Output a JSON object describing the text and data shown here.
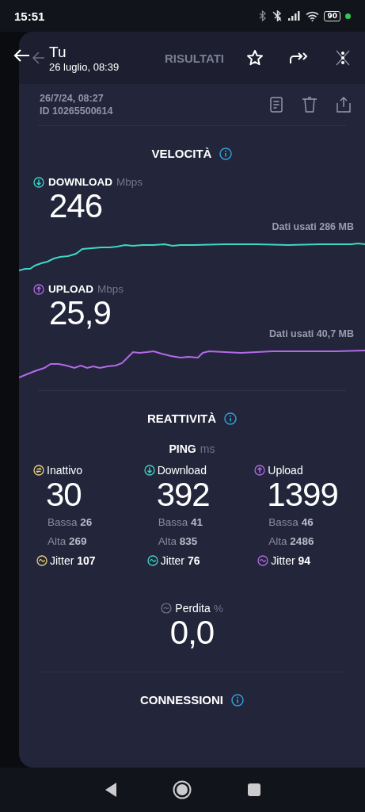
{
  "status_bar": {
    "time": "15:51",
    "battery": "90"
  },
  "overlay_header": {
    "title": "Tu",
    "subtitle": "26 luglio, 08:39"
  },
  "header": {
    "title": "RISULTATI"
  },
  "result": {
    "date": "26/7/24, 08:27",
    "id": "ID 10265500614"
  },
  "speed": {
    "title": "VELOCITÀ",
    "metrics": [
      {
        "kind": "download",
        "label": "DOWNLOAD",
        "unit": "Mbps",
        "value": "246",
        "data_used": "Dati usati 286 MB",
        "color": "#3fd6c6"
      },
      {
        "kind": "upload",
        "label": "UPLOAD",
        "unit": "Mbps",
        "value": "25,9",
        "data_used": "Dati usati 40,7 MB",
        "color": "#b36ae8"
      }
    ]
  },
  "responsiveness": {
    "title": "REATTIVITÀ",
    "ping_label": "PING",
    "ping_unit": "ms",
    "columns": [
      {
        "kind": "idle",
        "label": "Inattivo",
        "value": "30",
        "low_label": "Bassa",
        "low": "26",
        "high_label": "Alta",
        "high": "269",
        "jitter_label": "Jitter",
        "jitter": "107",
        "color": "#e8d27a"
      },
      {
        "kind": "download",
        "label": "Download",
        "value": "392",
        "low_label": "Bassa",
        "low": "41",
        "high_label": "Alta",
        "high": "835",
        "jitter_label": "Jitter",
        "jitter": "76",
        "color": "#3fd6c6"
      },
      {
        "kind": "upload",
        "label": "Upload",
        "value": "1399",
        "low_label": "Bassa",
        "low": "46",
        "high_label": "Alta",
        "high": "2486",
        "jitter_label": "Jitter",
        "jitter": "94",
        "color": "#b36ae8"
      }
    ]
  },
  "loss": {
    "label": "Perdita",
    "unit": "%",
    "value": "0,0"
  },
  "connections": {
    "title": "CONNESSIONI"
  }
}
